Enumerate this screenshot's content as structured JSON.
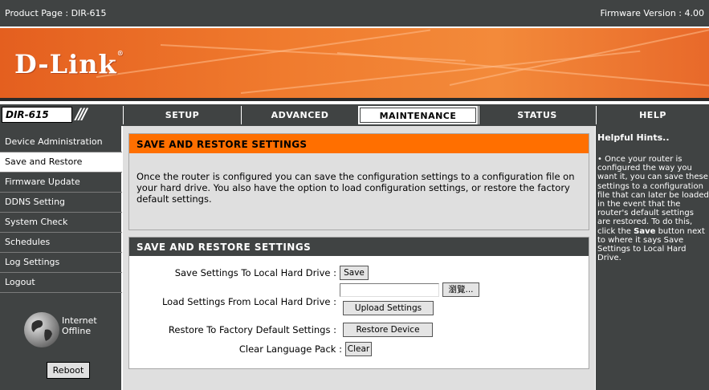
{
  "topbar": {
    "product": "Product Page : DIR-615",
    "firmware": "Firmware Version : 4.00"
  },
  "banner": {
    "logo": "D-Link",
    "logo_mark": "®"
  },
  "nav": {
    "model": "DIR-615",
    "tabs": [
      {
        "label": "SETUP"
      },
      {
        "label": "ADVANCED"
      },
      {
        "label": "MAINTENANCE"
      },
      {
        "label": "STATUS"
      },
      {
        "label": "HELP"
      }
    ]
  },
  "sidebar": {
    "items": [
      {
        "label": "Device Administration"
      },
      {
        "label": "Save and Restore"
      },
      {
        "label": "Firmware Update"
      },
      {
        "label": "DDNS Setting"
      },
      {
        "label": "System Check"
      },
      {
        "label": "Schedules"
      },
      {
        "label": "Log Settings"
      },
      {
        "label": "Logout"
      }
    ],
    "internet_status_line1": "Internet",
    "internet_status_line2": "Offline",
    "reboot_label": "Reboot"
  },
  "main": {
    "intro_header": "SAVE AND RESTORE SETTINGS",
    "intro_text": "Once the router is configured you can save the configuration settings to a configuration file on your hard drive. You also have the option to load configuration settings, or restore the factory default settings.",
    "section_header": "SAVE AND RESTORE SETTINGS",
    "save_label": "Save Settings To Local Hard Drive :",
    "save_button": "Save",
    "load_label": "Load Settings From Local Hard Drive :",
    "browse_button": "瀏覽...",
    "upload_button": "Upload Settings",
    "restore_label": "Restore To Factory Default Settings :",
    "restore_button": "Restore Device",
    "clear_label": "Clear Language Pack :",
    "clear_button": "Clear"
  },
  "help": {
    "title": "Helpful Hints..",
    "text_1": "• Once your router is configured the way you want it, you can save these settings to a configuration file that can later be loaded in the event that the router's default settings are restored. To do this, click the ",
    "text_bold": "Save",
    "text_2": " button next to where it says Save Settings to Local Hard Drive."
  },
  "colors": {
    "accent": "#ff6f00",
    "nav_bg": "#404343",
    "content_bg": "#dfdfdf"
  }
}
